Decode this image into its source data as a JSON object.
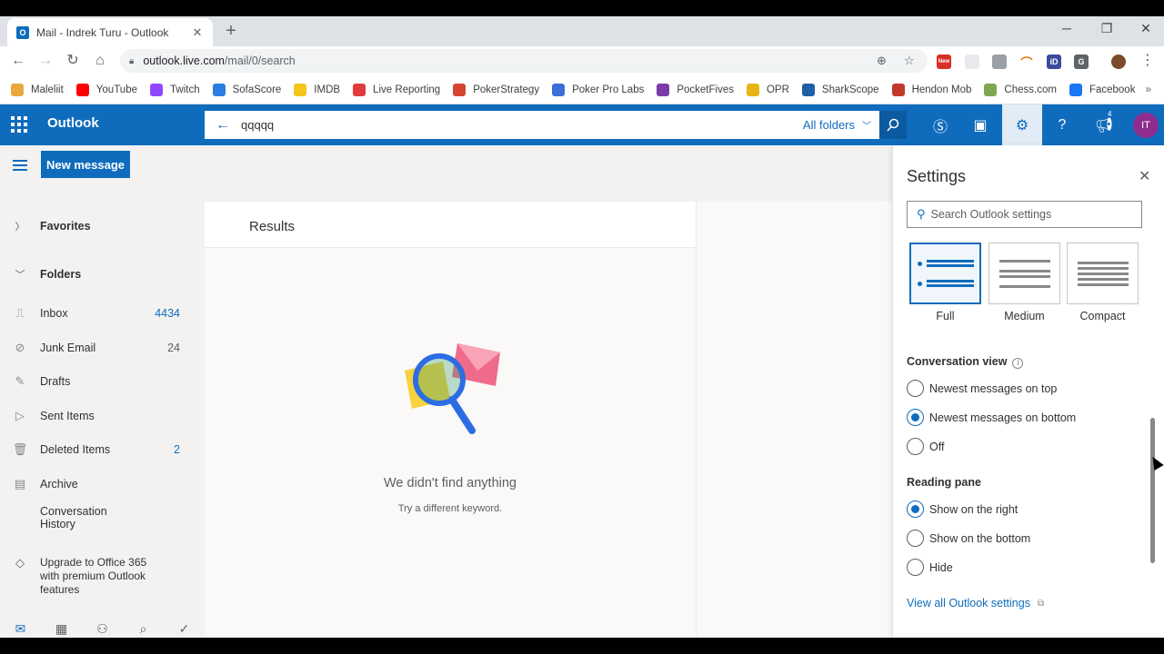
{
  "browser": {
    "tab_title": "Mail - Indrek Turu - Outlook",
    "tab_favicon": "O",
    "url_host": "outlook.live.com",
    "url_path": "/mail/0/search",
    "bookmarks": [
      {
        "label": "Maleliit",
        "color": "#e8a83c"
      },
      {
        "label": "YouTube",
        "color": "#ff0000"
      },
      {
        "label": "Twitch",
        "color": "#9146ff"
      },
      {
        "label": "SofaScore",
        "color": "#2a7de1"
      },
      {
        "label": "IMDB",
        "color": "#f5c518"
      },
      {
        "label": "Live Reporting",
        "color": "#e03a3a"
      },
      {
        "label": "PokerStrategy",
        "color": "#d6452f"
      },
      {
        "label": "Poker Pro Labs",
        "color": "#3a6fd8"
      },
      {
        "label": "PocketFives",
        "color": "#7a3aa8"
      },
      {
        "label": "OPR",
        "color": "#e7b416"
      },
      {
        "label": "SharkScope",
        "color": "#1f5fa8"
      },
      {
        "label": "Hendon Mob",
        "color": "#c0392b"
      },
      {
        "label": "Chess.com",
        "color": "#7fa650"
      },
      {
        "label": "Facebook",
        "color": "#1877f2"
      }
    ],
    "ext_badge_new": "New",
    "ext_id_label": "iD",
    "ext_g_label": "G"
  },
  "outlook": {
    "brand": "Outlook",
    "search_query": "qqqqq",
    "search_scope": "All folders",
    "avatar_initials": "IT",
    "notif_count": "4",
    "new_message_label": "New message",
    "favorites_label": "Favorites",
    "folders_label": "Folders",
    "folders": [
      {
        "label": "Inbox",
        "count": "4434",
        "icon": "inbox-icon"
      },
      {
        "label": "Junk Email",
        "count": "24",
        "icon": "junk-icon"
      },
      {
        "label": "Drafts",
        "count": "",
        "icon": "drafts-icon"
      },
      {
        "label": "Sent Items",
        "count": "",
        "icon": "sent-icon"
      },
      {
        "label": "Deleted Items",
        "count": "2",
        "icon": "trash-icon"
      },
      {
        "label": "Archive",
        "count": "",
        "icon": "archive-icon"
      },
      {
        "label": "Conversation History",
        "count": "",
        "icon": ""
      }
    ],
    "upgrade_text": "Upgrade to Office 365 with premium Outlook features",
    "results_title": "Results",
    "empty_title": "We didn't find anything",
    "empty_hint": "Try a different keyword."
  },
  "settings": {
    "title": "Settings",
    "search_placeholder": "Search Outlook settings",
    "density": [
      "Full",
      "Medium",
      "Compact"
    ],
    "density_selected": "Full",
    "conversation_label": "Conversation view",
    "conversation_options": [
      "Newest messages on top",
      "Newest messages on bottom",
      "Off"
    ],
    "conversation_selected": "Newest messages on bottom",
    "reading_label": "Reading pane",
    "reading_options": [
      "Show on the right",
      "Show on the bottom",
      "Hide"
    ],
    "reading_selected": "Show on the right",
    "view_all_link": "View all Outlook settings"
  },
  "colors": {
    "accent": "#0f6cbd",
    "avatar": "#8e2d8e"
  }
}
